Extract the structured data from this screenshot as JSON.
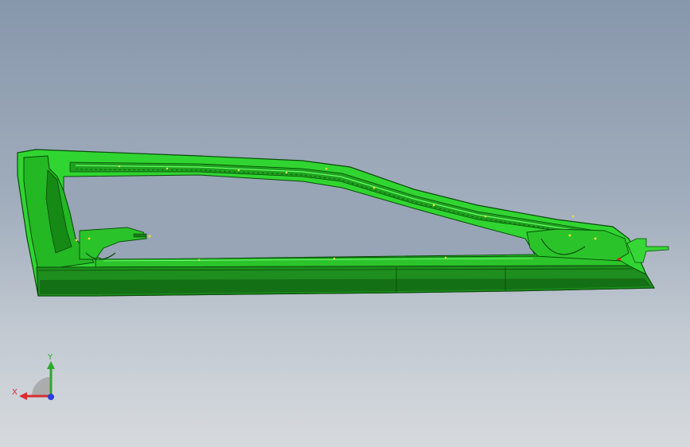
{
  "viewport": {
    "background_top": "#8797ab",
    "background_bottom": "#d6dade"
  },
  "model": {
    "name": "door-frame-part",
    "body_color": "#2fcf2f",
    "edge_color": "#0a4a0a",
    "shadow_color": "#0f6a12",
    "sill_color": "#1d8a1d"
  },
  "triad": {
    "x_label": "X",
    "y_label": "Y",
    "x_color": "#d63030",
    "y_color": "#2fa82f",
    "z_color": "#2b3fd8"
  }
}
